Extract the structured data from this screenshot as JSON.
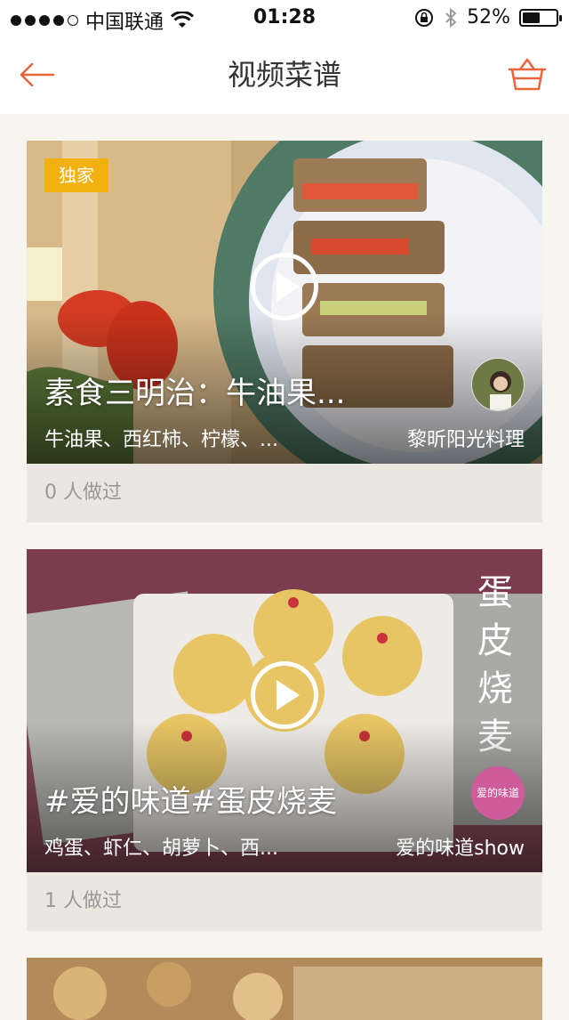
{
  "status_bar": {
    "carrier": "中国联通",
    "time": "01:28",
    "battery_text": "52%",
    "battery_level": 0.52,
    "signal_bars": 4,
    "icons": [
      "signal-dots-icon",
      "wifi-icon",
      "rotation-lock-icon",
      "bluetooth-icon",
      "battery-icon"
    ]
  },
  "nav": {
    "title": "视频菜谱",
    "back_icon": "back-arrow-icon",
    "cart_icon": "basket-icon",
    "accent_color": "#e8663c"
  },
  "recipes": [
    {
      "badge": "独家",
      "title": "素食三明治：牛油果...",
      "ingredients": "牛油果、西红柿、柠檬、...",
      "author": "黎昕阳光料理",
      "cooked": "0 人做过"
    },
    {
      "badge": "",
      "title": "#爱的味道#蛋皮烧麦",
      "ingredients": "鸡蛋、虾仁、胡萝卜、西...",
      "author": "爱的味道show",
      "cooked": "1 人做过",
      "image_text": "蛋皮烧麦",
      "stamp_text": "爱的味道"
    }
  ]
}
